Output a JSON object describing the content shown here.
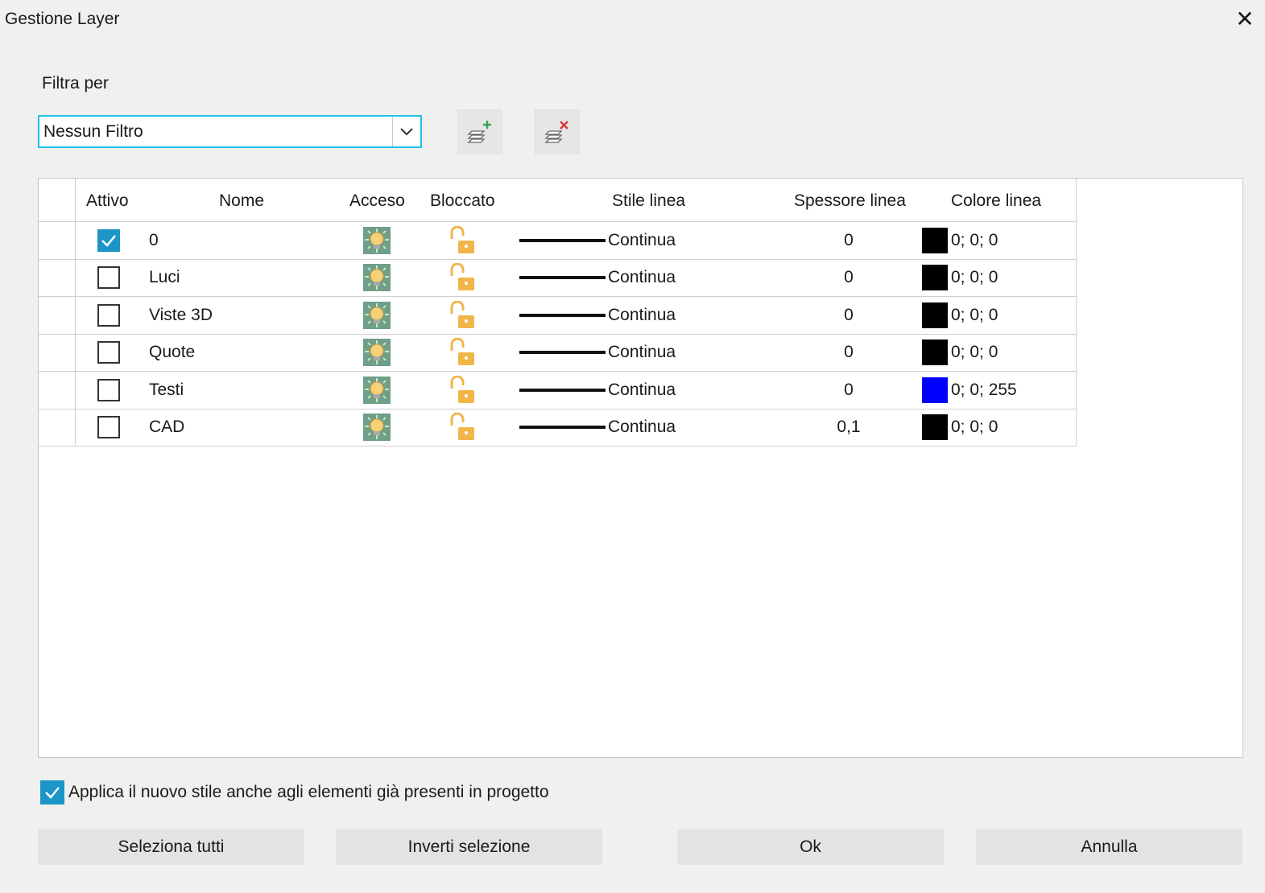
{
  "window": {
    "title": "Gestione Layer"
  },
  "filter": {
    "label": "Filtra per",
    "selected": "Nessun Filtro"
  },
  "table": {
    "headers": {
      "attivo": "Attivo",
      "nome": "Nome",
      "acceso": "Acceso",
      "bloccato": "Bloccato",
      "stile": "Stile linea",
      "spessore": "Spessore linea",
      "colore": "Colore linea"
    },
    "rows": [
      {
        "active": true,
        "name": "0",
        "on": true,
        "locked": false,
        "style": "Continua",
        "thickness": "0",
        "color_text": "0; 0; 0",
        "color": "#000000"
      },
      {
        "active": false,
        "name": "Luci",
        "on": true,
        "locked": false,
        "style": "Continua",
        "thickness": "0",
        "color_text": "0; 0; 0",
        "color": "#000000"
      },
      {
        "active": false,
        "name": "Viste 3D",
        "on": true,
        "locked": false,
        "style": "Continua",
        "thickness": "0",
        "color_text": "0; 0; 0",
        "color": "#000000"
      },
      {
        "active": false,
        "name": "Quote",
        "on": true,
        "locked": false,
        "style": "Continua",
        "thickness": "0",
        "color_text": "0; 0; 0",
        "color": "#000000"
      },
      {
        "active": false,
        "name": "Testi",
        "on": true,
        "locked": false,
        "style": "Continua",
        "thickness": "0",
        "color_text": "0; 0; 255",
        "color": "#0000ff"
      },
      {
        "active": false,
        "name": "CAD",
        "on": true,
        "locked": false,
        "style": "Continua",
        "thickness": "0,1",
        "color_text": "0; 0; 0",
        "color": "#000000"
      }
    ]
  },
  "apply_option": {
    "label": "Applica il nuovo stile anche agli elementi già presenti in progetto",
    "checked": true
  },
  "buttons": {
    "select_all": "Seleziona tutti",
    "invert": "Inverti selezione",
    "ok": "Ok",
    "cancel": "Annulla"
  },
  "icons": {
    "add_layer": "layer-add-icon",
    "delete_layer": "layer-delete-icon",
    "bulb": "light-bulb-icon",
    "lock": "unlocked-padlock-icon"
  },
  "colors": {
    "accent": "#1b96c7",
    "focus": "#1fc1ec"
  }
}
